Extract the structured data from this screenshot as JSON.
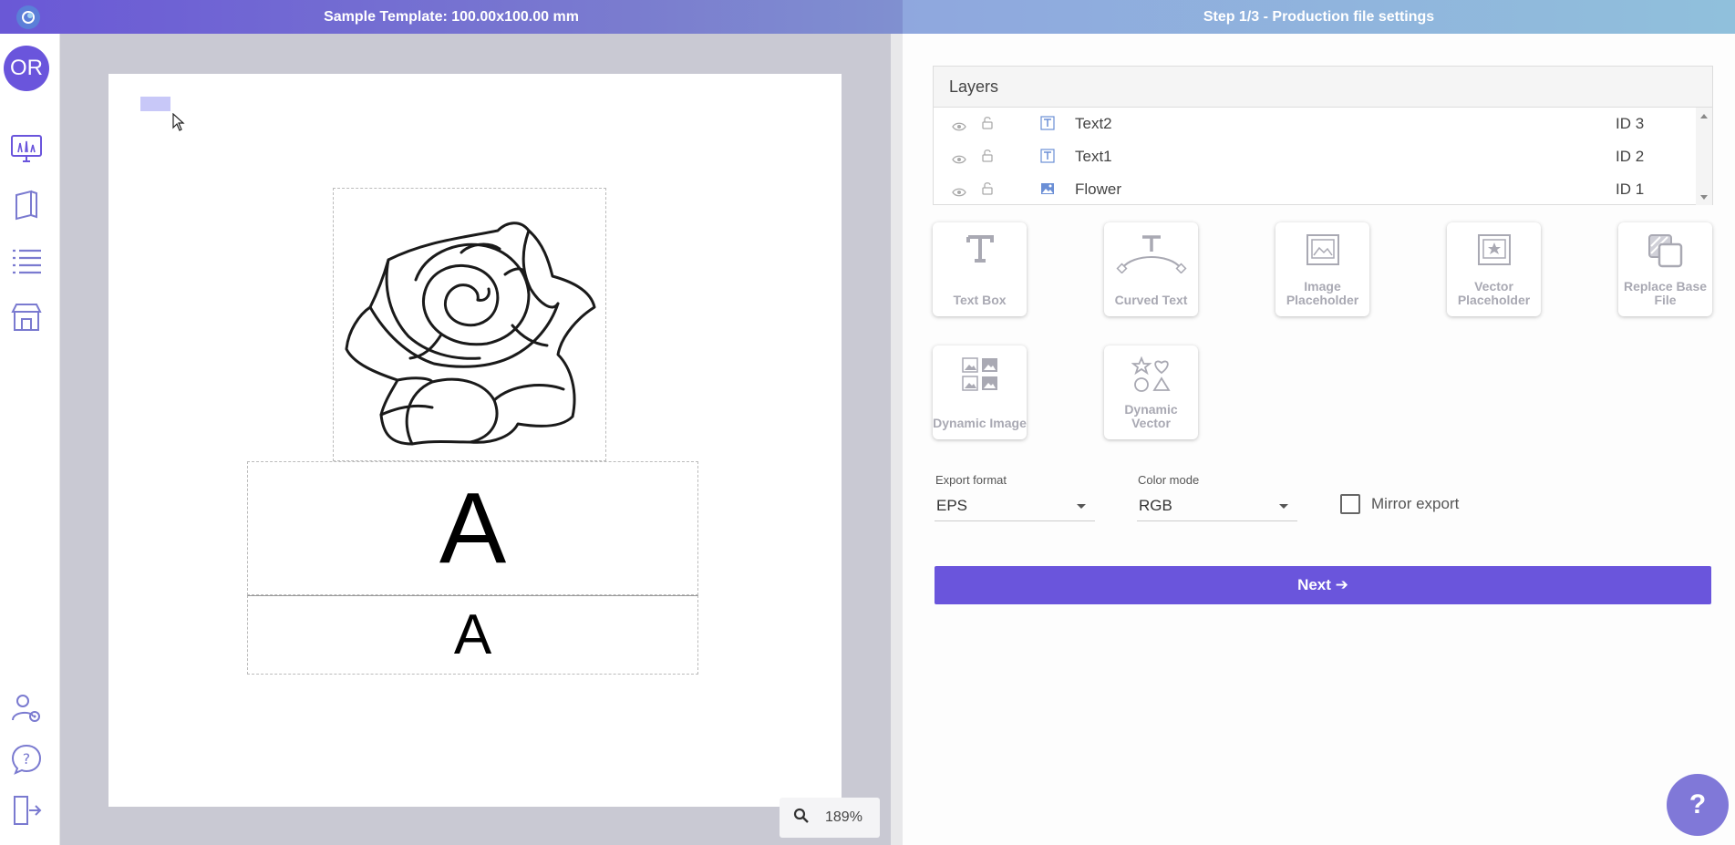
{
  "header": {
    "template_title": "Sample Template: 100.00x100.00 mm",
    "step_title": "Step 1/3 - Production file settings"
  },
  "sidebar": {
    "avatar_initials": "OR",
    "items": [
      {
        "name": "designer",
        "icon": "monitor-pen-icon"
      },
      {
        "name": "templates",
        "icon": "book-icon"
      },
      {
        "name": "list",
        "icon": "list-icon"
      },
      {
        "name": "store",
        "icon": "store-icon"
      },
      {
        "name": "account-settings",
        "icon": "user-gear-icon"
      },
      {
        "name": "help",
        "icon": "question-chat-icon"
      },
      {
        "name": "logout",
        "icon": "logout-icon"
      }
    ]
  },
  "canvas": {
    "text_large": "A",
    "text_small": "A",
    "zoom": "189%"
  },
  "layers": {
    "title": "Layers",
    "rows": [
      {
        "name": "Text2",
        "id": "ID 3",
        "type": "text"
      },
      {
        "name": "Text1",
        "id": "ID 2",
        "type": "text"
      },
      {
        "name": "Flower",
        "id": "ID 1",
        "type": "image"
      }
    ]
  },
  "tools": [
    {
      "label": "Text Box"
    },
    {
      "label": "Curved Text"
    },
    {
      "label": "Image Placeholder"
    },
    {
      "label": "Vector Placeholder"
    },
    {
      "label": "Replace Base File"
    },
    {
      "label": "Dynamic Image"
    },
    {
      "label": "Dynamic Vector"
    }
  ],
  "export": {
    "format_label": "Export format",
    "format_value": "EPS",
    "color_label": "Color mode",
    "color_value": "RGB",
    "mirror_label": "Mirror export",
    "mirror_checked": false
  },
  "next_button": "Next ➔",
  "help_button": "?",
  "colors": {
    "accent": "#6a55dc",
    "canvas_bg": "#c9c9d3"
  }
}
